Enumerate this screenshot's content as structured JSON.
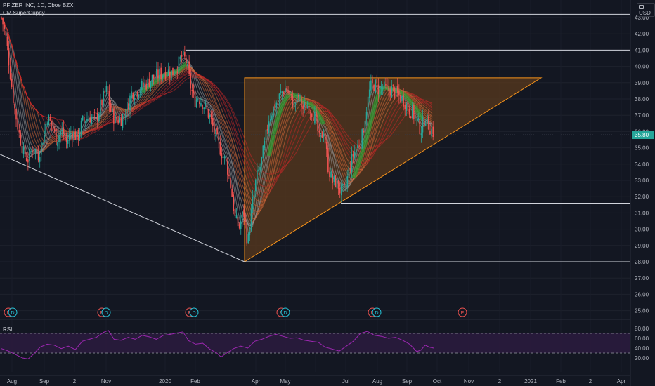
{
  "header": {
    "symbol_line": "PFIZER INC, 1D, Cboe BZX",
    "indicator_label": "CM SuperGuppy",
    "currency_label": "USD"
  },
  "rsi_pane": {
    "label": "RSI",
    "levels": [
      70,
      30
    ]
  },
  "chart_data": {
    "type": "candlestick",
    "title": "PFIZER INC, 1D, Cboe BZX",
    "indicators": [
      "CM SuperGuppy",
      "RSI"
    ],
    "x_tick_labels": [
      "Aug",
      "Sep",
      "2",
      "Nov",
      "2020",
      "Feb",
      "Apr",
      "May",
      "Jul",
      "Aug",
      "Sep",
      "Oct",
      "Nov",
      "2",
      "2021",
      "Feb",
      "2",
      "Apr"
    ],
    "y_axis": {
      "ylim": [
        24.5,
        43.5
      ],
      "tick_labels": [
        "25.00",
        "26.00",
        "27.00",
        "28.00",
        "29.00",
        "30.00",
        "31.00",
        "32.00",
        "33.00",
        "34.00",
        "35.00",
        "36.00",
        "37.00",
        "38.00",
        "39.00",
        "40.00",
        "41.00",
        "42.00",
        "43.00"
      ],
      "current_price_tag": "35.80"
    },
    "rsi_axis": {
      "ylim": [
        12,
        82
      ],
      "tick_labels": [
        "20.00",
        "40.00",
        "60.00",
        "80.00"
      ]
    },
    "horizontal_levels": [
      43.2,
      41.0,
      31.6,
      28.0
    ],
    "triangle_drawing": {
      "apex_price": 28.0,
      "top_price": 39.3,
      "lower_right_price": 39.3
    },
    "trend_line": {
      "start_price": 34.6,
      "end_price": 28.0
    },
    "price_series": [
      {
        "t": 0,
        "p": 43.0
      },
      {
        "t": 3,
        "p": 42.5
      },
      {
        "t": 7,
        "p": 41.6
      },
      {
        "t": 12,
        "p": 39.8
      },
      {
        "t": 18,
        "p": 37.6
      },
      {
        "t": 25,
        "p": 35.9
      },
      {
        "t": 32,
        "p": 34.6
      },
      {
        "t": 38,
        "p": 34.3
      },
      {
        "t": 45,
        "p": 35.1
      },
      {
        "t": 52,
        "p": 34.5
      },
      {
        "t": 58,
        "p": 35.4
      },
      {
        "t": 65,
        "p": 36.9
      },
      {
        "t": 72,
        "p": 36.4
      },
      {
        "t": 78,
        "p": 35.5
      },
      {
        "t": 85,
        "p": 36.1
      },
      {
        "t": 92,
        "p": 35.3
      },
      {
        "t": 100,
        "p": 36.0
      },
      {
        "t": 108,
        "p": 35.6
      },
      {
        "t": 115,
        "p": 36.6
      },
      {
        "t": 125,
        "p": 36.9
      },
      {
        "t": 135,
        "p": 36.8
      },
      {
        "t": 145,
        "p": 38.1
      },
      {
        "t": 150,
        "p": 38.6
      },
      {
        "t": 155,
        "p": 37.3
      },
      {
        "t": 162,
        "p": 36.7
      },
      {
        "t": 170,
        "p": 36.8
      },
      {
        "t": 178,
        "p": 37.4
      },
      {
        "t": 185,
        "p": 38.4
      },
      {
        "t": 195,
        "p": 38.6
      },
      {
        "t": 205,
        "p": 38.9
      },
      {
        "t": 215,
        "p": 39.3
      },
      {
        "t": 225,
        "p": 39.5
      },
      {
        "t": 235,
        "p": 39.7
      },
      {
        "t": 243,
        "p": 39.6
      },
      {
        "t": 250,
        "p": 40.0
      },
      {
        "t": 256,
        "p": 40.6
      },
      {
        "t": 262,
        "p": 40.4
      },
      {
        "t": 268,
        "p": 38.9
      },
      {
        "t": 274,
        "p": 37.9
      },
      {
        "t": 280,
        "p": 38.1
      },
      {
        "t": 288,
        "p": 37.6
      },
      {
        "t": 296,
        "p": 36.9
      },
      {
        "t": 304,
        "p": 35.7
      },
      {
        "t": 312,
        "p": 34.8
      },
      {
        "t": 320,
        "p": 34.0
      },
      {
        "t": 326,
        "p": 32.6
      },
      {
        "t": 332,
        "p": 30.6
      },
      {
        "t": 338,
        "p": 30.1
      },
      {
        "t": 344,
        "p": 31.1
      },
      {
        "t": 350,
        "p": 29.1
      },
      {
        "t": 356,
        "p": 31.4
      },
      {
        "t": 362,
        "p": 33.1
      },
      {
        "t": 368,
        "p": 33.9
      },
      {
        "t": 374,
        "p": 35.2
      },
      {
        "t": 380,
        "p": 36.8
      },
      {
        "t": 386,
        "p": 37.4
      },
      {
        "t": 392,
        "p": 37.9
      },
      {
        "t": 398,
        "p": 38.4
      },
      {
        "t": 404,
        "p": 38.7
      },
      {
        "t": 410,
        "p": 38.1
      },
      {
        "t": 416,
        "p": 37.6
      },
      {
        "t": 422,
        "p": 38.2
      },
      {
        "t": 428,
        "p": 37.4
      },
      {
        "t": 434,
        "p": 37.6
      },
      {
        "t": 440,
        "p": 37.4
      },
      {
        "t": 446,
        "p": 36.8
      },
      {
        "t": 452,
        "p": 35.4
      },
      {
        "t": 458,
        "p": 36.1
      },
      {
        "t": 464,
        "p": 33.9
      },
      {
        "t": 470,
        "p": 32.9
      },
      {
        "t": 476,
        "p": 32.9
      },
      {
        "t": 482,
        "p": 32.3
      },
      {
        "t": 488,
        "p": 32.4
      },
      {
        "t": 494,
        "p": 33.7
      },
      {
        "t": 500,
        "p": 34.6
      },
      {
        "t": 506,
        "p": 35.1
      },
      {
        "t": 512,
        "p": 35.6
      },
      {
        "t": 518,
        "p": 37.3
      },
      {
        "t": 524,
        "p": 38.7
      },
      {
        "t": 530,
        "p": 38.9
      },
      {
        "t": 536,
        "p": 38.6
      },
      {
        "t": 542,
        "p": 38.7
      },
      {
        "t": 548,
        "p": 38.5
      },
      {
        "t": 554,
        "p": 38.6
      },
      {
        "t": 560,
        "p": 38.4
      },
      {
        "t": 566,
        "p": 38.1
      },
      {
        "t": 572,
        "p": 37.9
      },
      {
        "t": 578,
        "p": 37.4
      },
      {
        "t": 584,
        "p": 37.2
      },
      {
        "t": 590,
        "p": 36.6
      },
      {
        "t": 596,
        "p": 36.1
      },
      {
        "t": 602,
        "p": 36.9
      },
      {
        "t": 608,
        "p": 36.3
      },
      {
        "t": 614,
        "p": 35.9
      }
    ],
    "rsi_series": [
      {
        "t": 0,
        "v": 39
      },
      {
        "t": 10,
        "v": 34
      },
      {
        "t": 20,
        "v": 27
      },
      {
        "t": 30,
        "v": 20
      },
      {
        "t": 38,
        "v": 18
      },
      {
        "t": 45,
        "v": 27
      },
      {
        "t": 55,
        "v": 42
      },
      {
        "t": 65,
        "v": 48
      },
      {
        "t": 75,
        "v": 46
      },
      {
        "t": 85,
        "v": 39
      },
      {
        "t": 95,
        "v": 44
      },
      {
        "t": 105,
        "v": 37
      },
      {
        "t": 115,
        "v": 54
      },
      {
        "t": 125,
        "v": 58
      },
      {
        "t": 135,
        "v": 62
      },
      {
        "t": 145,
        "v": 72
      },
      {
        "t": 152,
        "v": 76
      },
      {
        "t": 160,
        "v": 58
      },
      {
        "t": 170,
        "v": 56
      },
      {
        "t": 180,
        "v": 62
      },
      {
        "t": 190,
        "v": 58
      },
      {
        "t": 200,
        "v": 66
      },
      {
        "t": 210,
        "v": 63
      },
      {
        "t": 220,
        "v": 58
      },
      {
        "t": 230,
        "v": 66
      },
      {
        "t": 240,
        "v": 68
      },
      {
        "t": 250,
        "v": 71
      },
      {
        "t": 258,
        "v": 73
      },
      {
        "t": 266,
        "v": 55
      },
      {
        "t": 276,
        "v": 48
      },
      {
        "t": 286,
        "v": 50
      },
      {
        "t": 296,
        "v": 38
      },
      {
        "t": 306,
        "v": 30
      },
      {
        "t": 312,
        "v": 22
      },
      {
        "t": 320,
        "v": 30
      },
      {
        "t": 330,
        "v": 39
      },
      {
        "t": 340,
        "v": 44
      },
      {
        "t": 350,
        "v": 40
      },
      {
        "t": 360,
        "v": 54
      },
      {
        "t": 370,
        "v": 58
      },
      {
        "t": 380,
        "v": 64
      },
      {
        "t": 390,
        "v": 68
      },
      {
        "t": 400,
        "v": 64
      },
      {
        "t": 410,
        "v": 60
      },
      {
        "t": 420,
        "v": 61
      },
      {
        "t": 430,
        "v": 56
      },
      {
        "t": 440,
        "v": 54
      },
      {
        "t": 450,
        "v": 52
      },
      {
        "t": 460,
        "v": 42
      },
      {
        "t": 470,
        "v": 38
      },
      {
        "t": 480,
        "v": 34
      },
      {
        "t": 490,
        "v": 44
      },
      {
        "t": 500,
        "v": 54
      },
      {
        "t": 510,
        "v": 70
      },
      {
        "t": 520,
        "v": 74
      },
      {
        "t": 530,
        "v": 66
      },
      {
        "t": 540,
        "v": 64
      },
      {
        "t": 550,
        "v": 60
      },
      {
        "t": 560,
        "v": 62
      },
      {
        "t": 570,
        "v": 56
      },
      {
        "t": 580,
        "v": 48
      },
      {
        "t": 590,
        "v": 33
      },
      {
        "t": 596,
        "v": 36
      },
      {
        "t": 602,
        "v": 46
      },
      {
        "t": 608,
        "v": 42
      },
      {
        "t": 614,
        "v": 40
      }
    ],
    "event_markers": [
      {
        "letters": [
          "E",
          "D"
        ]
      },
      {
        "letters": [
          "E",
          "D"
        ]
      },
      {
        "letters": [
          "E",
          "D"
        ]
      },
      {
        "letters": [
          "E",
          "D"
        ]
      },
      {
        "letters": [
          "E",
          "D"
        ]
      },
      {
        "letters": [
          "E"
        ]
      }
    ],
    "colors": {
      "background": "#131722",
      "up_candle": "#26a69a",
      "down_candle": "#ef5350",
      "triangle_fill": "#5a3a1e",
      "triangle_stroke": "#f7931a",
      "rsi_line": "#9c27b0",
      "rsi_band": "#2a1b3d",
      "guppy_bear": "#c62828",
      "guppy_bull": "#2e9b2e",
      "guppy_neutral": "#9e9e9e",
      "earnings_marker": "#ef5350",
      "dividend_marker": "#26c6da"
    }
  }
}
